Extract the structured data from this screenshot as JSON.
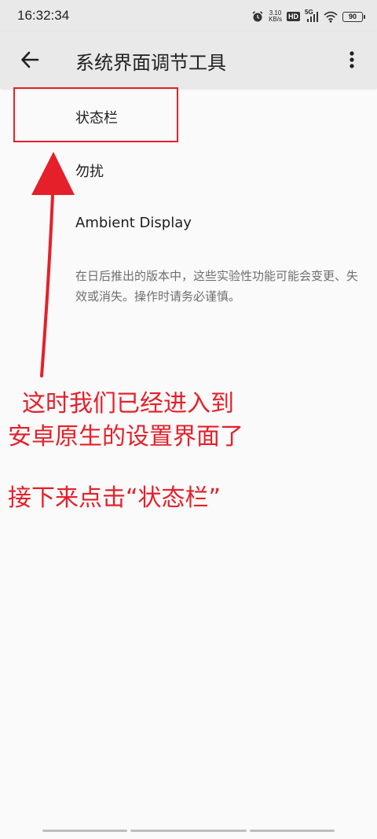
{
  "status_bar": {
    "time": "16:32:34",
    "net_speed_value": "3.10",
    "net_speed_unit": "KB/s",
    "hd_label": "HD",
    "network_label": "5G",
    "battery_level": "90",
    "icons": [
      "alarm-icon",
      "wifi-icon",
      "signal-icon",
      "battery-icon"
    ]
  },
  "app_bar": {
    "title": "系统界面调节工具",
    "back_icon": "arrow-left-icon",
    "menu_icon": "more-vertical-icon"
  },
  "list": {
    "items": [
      {
        "label": "状态栏"
      },
      {
        "label": "勿扰"
      },
      {
        "label": "Ambient Display"
      }
    ],
    "footer_note": "在日后推出的版本中，这些实验性功能可能会变更、失效或消失。操作时请务必谨慎。"
  },
  "annotation": {
    "color": "#e5202a",
    "lines": [
      "这时我们已经进入到",
      "安卓原生的设置界面了",
      "接下来点击“状态栏”"
    ]
  }
}
